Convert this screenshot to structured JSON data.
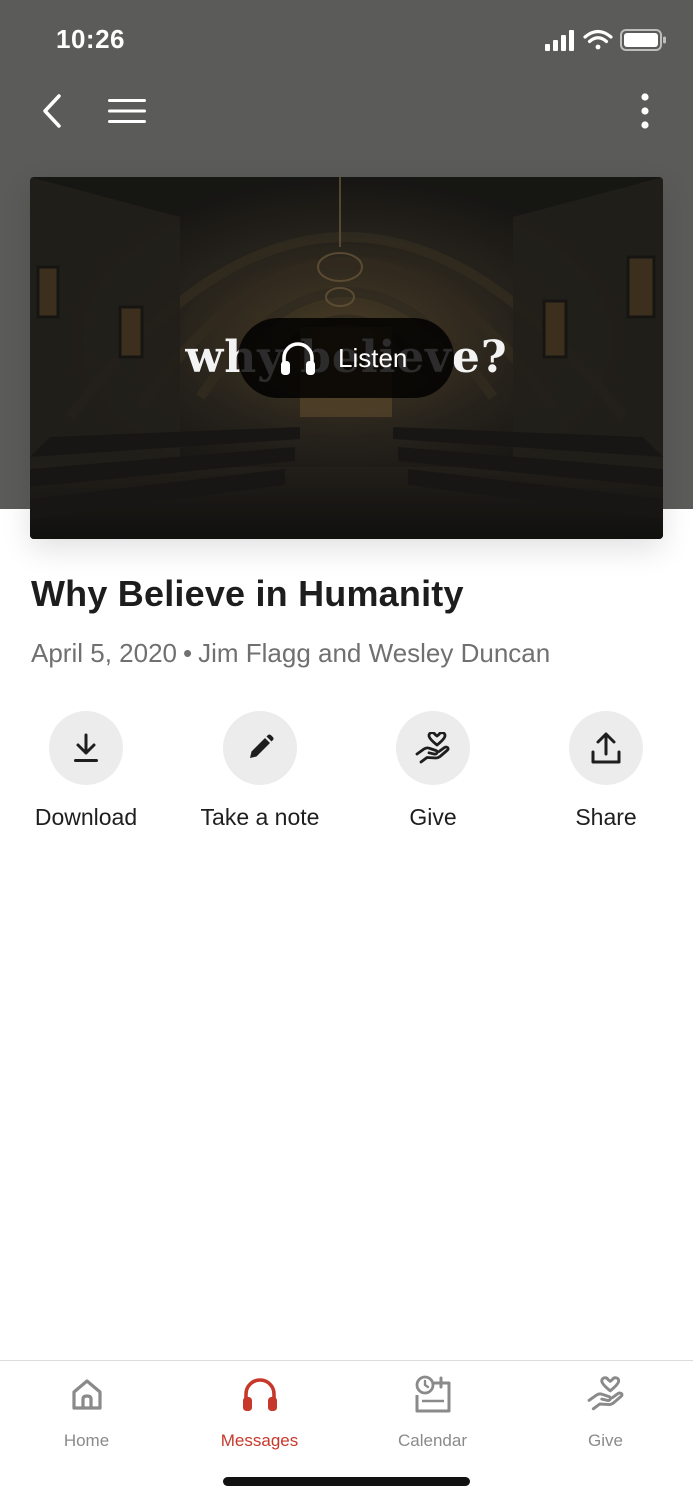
{
  "status": {
    "time": "10:26"
  },
  "hero": {
    "title_text": "why believe?",
    "listen_label": "Listen"
  },
  "message": {
    "title": "Why Believe in Humanity",
    "date": "April 5, 2020",
    "separator": "•",
    "speakers": "Jim Flagg and Wesley Duncan"
  },
  "actions": [
    {
      "label": "Download",
      "icon": "download-icon"
    },
    {
      "label": "Take a note",
      "icon": "pencil-icon"
    },
    {
      "label": "Give",
      "icon": "heart-hand-icon"
    },
    {
      "label": "Share",
      "icon": "share-icon"
    }
  ],
  "tabs": [
    {
      "label": "Home",
      "icon": "home-icon",
      "active": false
    },
    {
      "label": "Messages",
      "icon": "headphones-icon",
      "active": true
    },
    {
      "label": "Calendar",
      "icon": "calendar-icon",
      "active": false
    },
    {
      "label": "Give",
      "icon": "heart-hand-icon",
      "active": false
    }
  ],
  "colors": {
    "header_background": "#5b5b5a",
    "accent": "#c7382a",
    "tab_inactive": "#8a8a8a",
    "action_circle": "#ececec"
  }
}
